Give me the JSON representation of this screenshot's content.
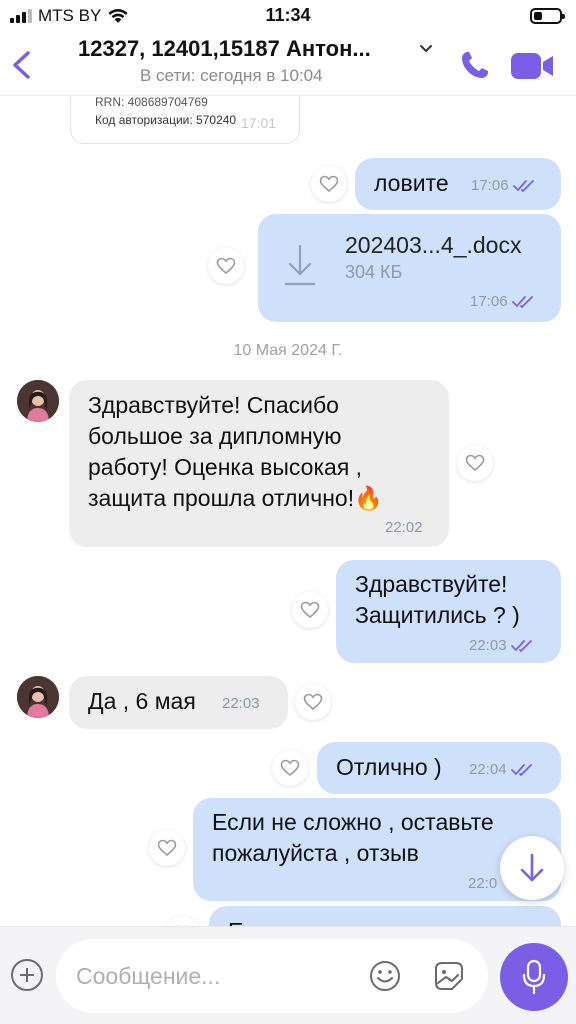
{
  "status_bar": {
    "carrier": "MTS BY",
    "time": "11:34",
    "battery_level": 0.35
  },
  "header": {
    "title": "12327, 12401,15187 Антон...",
    "subtitle": "В сети: сегодня в 10:04"
  },
  "receipt": {
    "rrn": "RRN: 408689704769",
    "auth_code": "Код авторизации: 570240",
    "time": "17:01"
  },
  "messages": {
    "m1": {
      "text": "ловите",
      "time": "17:06"
    },
    "file": {
      "name": "202403...4_.docx",
      "size": "304 КБ",
      "time": "17:06"
    },
    "date_separator": "10 Мая 2024 Г.",
    "m2": {
      "text": "Здравствуйте! Спасибо большое за дипломную работу! Оценка высокая , защита прошла отлично!🔥",
      "time": "22:02"
    },
    "m3": {
      "line1": "Здравствуйте!",
      "line2": "Защитились ? )",
      "time": "22:03"
    },
    "m4": {
      "text": "Да , 6 мая",
      "time": "22:03"
    },
    "m5": {
      "text": "Отлично )",
      "time": "22:04"
    },
    "m6": {
      "line1": "Если не сложно , оставьте",
      "line2": "пожалуйста , отзыв",
      "time": "22:0"
    },
    "m7": {
      "text": "Е"
    }
  },
  "composer": {
    "placeholder": "Сообщение..."
  },
  "colors": {
    "accent": "#7a5fe6",
    "outgoing_bubble": "#cfe0fb",
    "incoming_bubble": "#ededed"
  },
  "icons": [
    "back-arrow-icon",
    "chevron-down-icon",
    "phone-icon",
    "video-icon",
    "heart-icon",
    "download-icon",
    "double-check-icon",
    "plus-icon",
    "emoji-icon",
    "sticker-icon",
    "microphone-icon",
    "arrow-down-icon"
  ]
}
